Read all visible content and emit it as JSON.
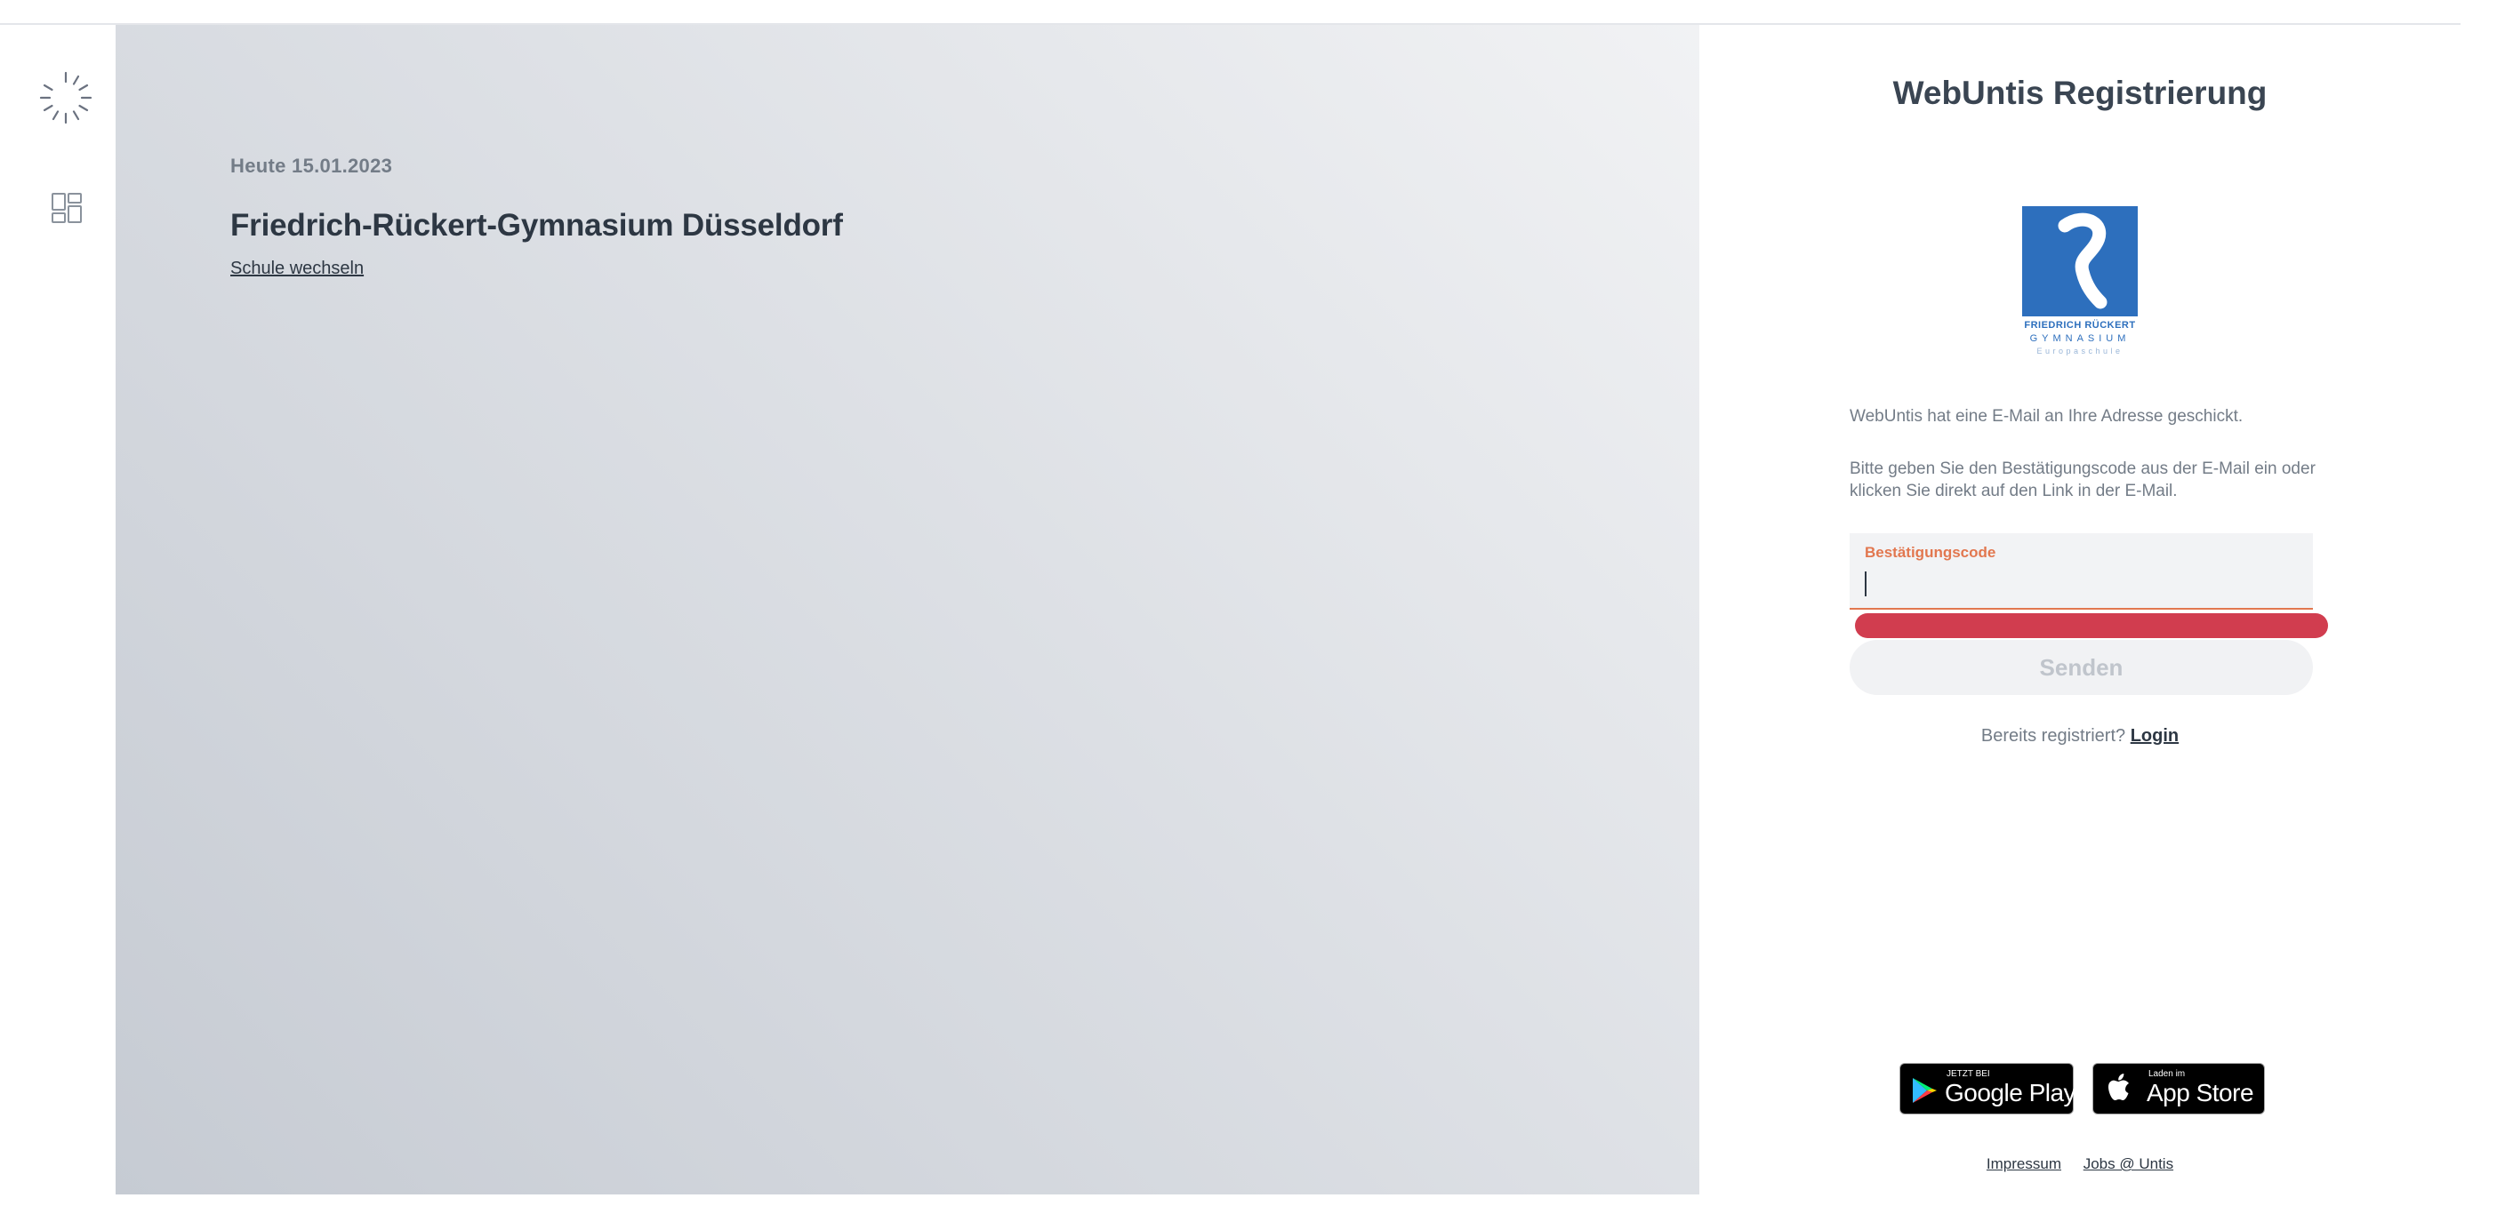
{
  "hero": {
    "date_label": "Heute",
    "date_value": "15.01.2023",
    "school_name": "Friedrich-Rückert-Gymnasium Düsseldorf",
    "switch_school_link": "Schule wechseln"
  },
  "rail": {
    "icons": [
      "loading-spinner-icon",
      "dashboard-icon"
    ]
  },
  "panel": {
    "title": "WebUntis Registrierung",
    "logo": {
      "line1": "FRIEDRICH RÜCKERT",
      "line2": "GYMNASIUM",
      "line3": "Europaschule"
    },
    "message_sent": "WebUntis hat eine E-Mail an Ihre Adresse geschickt.",
    "message_instructions": "Bitte geben Sie den Bestätigungscode aus der E-Mail ein oder klicken Sie direkt auf den Link in der E-Mail.",
    "code_field": {
      "label": "Bestätigungscode",
      "value": ""
    },
    "send_button": "Senden",
    "already_registered": "Bereits registriert?",
    "login_link": "Login",
    "google_play": {
      "small": "JETZT BEI",
      "big": "Google Play"
    },
    "app_store": {
      "small": "Laden im",
      "big": "App Store"
    },
    "footer": {
      "impressum": "Impressum",
      "jobs": "Jobs @ Untis"
    }
  },
  "colors": {
    "accent_orange": "#e2774f",
    "error_red": "#d13d4f",
    "logo_blue": "#2d6fbd",
    "text_dark": "#2d3743",
    "text_muted": "#737c87"
  }
}
